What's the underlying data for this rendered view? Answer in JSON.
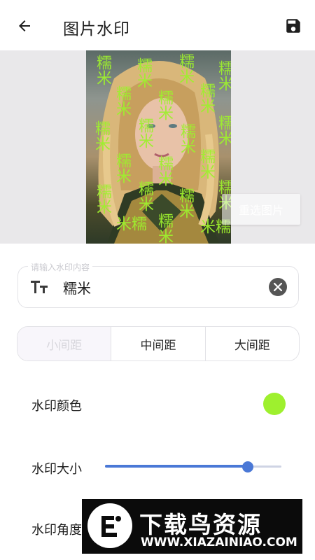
{
  "header": {
    "title": "图片水印",
    "back_icon": "arrow-left-icon",
    "save_icon": "floppy-disk-icon"
  },
  "preview": {
    "watermark_text": "糯米",
    "watermark_color": "#9ef02e",
    "reselect_label": "重选图片"
  },
  "input": {
    "label": "请输入水印内容",
    "value": "糯米",
    "leading_icon": "text-size-icon",
    "clear_icon": "clear-circle-icon"
  },
  "spacing": {
    "options": [
      "小间距",
      "中间距",
      "大间距"
    ],
    "selected": "小间距"
  },
  "settings": {
    "color_label": "水印颜色",
    "color_value": "#9ef02e",
    "size_label": "水印大小",
    "size_value": 0.81,
    "angle_label": "水印角度"
  },
  "ad": {
    "title": "下载鸟资源",
    "url": "WWW.XIAZAINIAO.COM"
  }
}
